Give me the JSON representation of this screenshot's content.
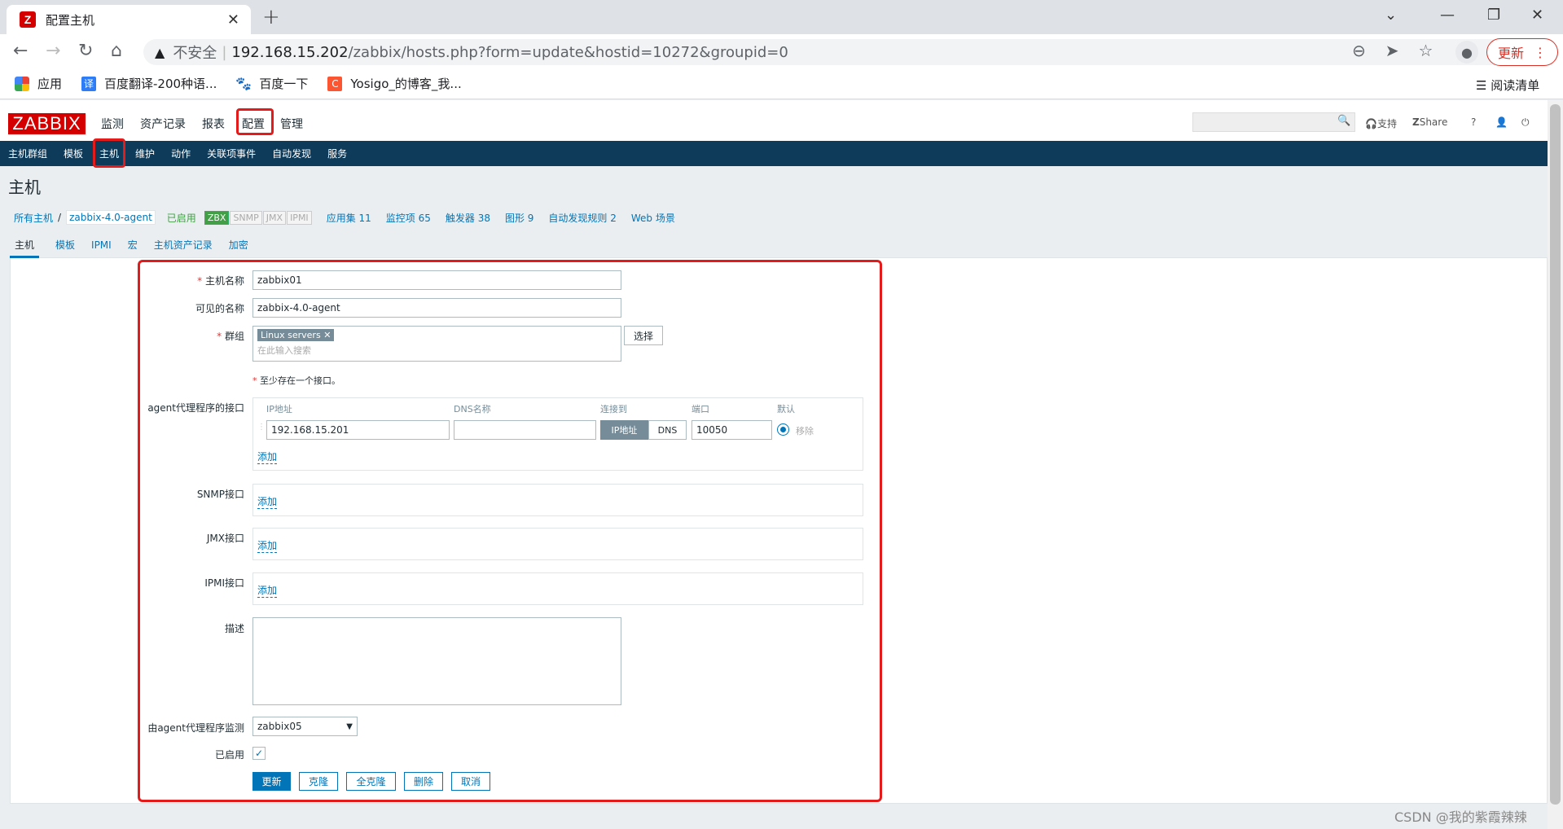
{
  "browser": {
    "tab_title": "配置主机",
    "favicon": "Z",
    "new_tab": "+",
    "security": "不安全",
    "url_host": "192.168.15.202",
    "url_path": "/zabbix/hosts.php?form=update&hostid=10272&groupid=0",
    "update_button": "更新",
    "bookmarks": [
      "应用",
      "百度翻译-200种语...",
      "百度一下",
      "Yosigo_的博客_我..."
    ],
    "reading_list": "阅读清单"
  },
  "zabbix": {
    "logo": "ZABBIX",
    "top_menu": [
      "监测",
      "资产记录",
      "报表",
      "配置",
      "管理"
    ],
    "support": "支持",
    "share": "Share",
    "help": "?",
    "sub_menu": [
      "主机群组",
      "模板",
      "主机",
      "维护",
      "动作",
      "关联项事件",
      "自动发现",
      "服务"
    ],
    "page_title": "主机",
    "breadcrumb": {
      "all_hosts": "所有主机",
      "sep": "/",
      "host": "zabbix-4.0-agent",
      "status": "已启用",
      "badges": [
        "ZBX",
        "SNMP",
        "JMX",
        "IPMI"
      ],
      "links": [
        "应用集 11",
        "监控项 65",
        "触发器 38",
        "图形 9",
        "自动发现规则 2",
        "Web 场景"
      ]
    },
    "form_tabs": [
      "主机",
      "模板",
      "IPMI",
      "宏",
      "主机资产记录",
      "加密"
    ]
  },
  "form": {
    "host_name_label": "主机名称",
    "host_name": "zabbix01",
    "visible_name_label": "可见的名称",
    "visible_name": "zabbix-4.0-agent",
    "groups_label": "群组",
    "group_tag": "Linux servers",
    "group_search_placeholder": "在此输入搜索",
    "select_button": "选择",
    "interface_note": "至少存在一个接口。",
    "agent_label": "agent代理程序的接口",
    "col_ip": "IP地址",
    "col_dns": "DNS名称",
    "col_connect": "连接到",
    "col_port": "端口",
    "col_default": "默认",
    "ip_value": "192.168.15.201",
    "dns_value": "",
    "connect_ip": "IP地址",
    "connect_dns": "DNS",
    "port_value": "10050",
    "remove": "移除",
    "add": "添加",
    "snmp_label": "SNMP接口",
    "jmx_label": "JMX接口",
    "ipmi_label": "IPMI接口",
    "desc_label": "描述",
    "proxy_label": "由agent代理程序监测",
    "proxy_value": "zabbix05",
    "enabled_label": "已启用",
    "buttons": [
      "更新",
      "克隆",
      "全克隆",
      "删除",
      "取消"
    ]
  },
  "watermark": "CSDN @我的紫霞辣辣"
}
